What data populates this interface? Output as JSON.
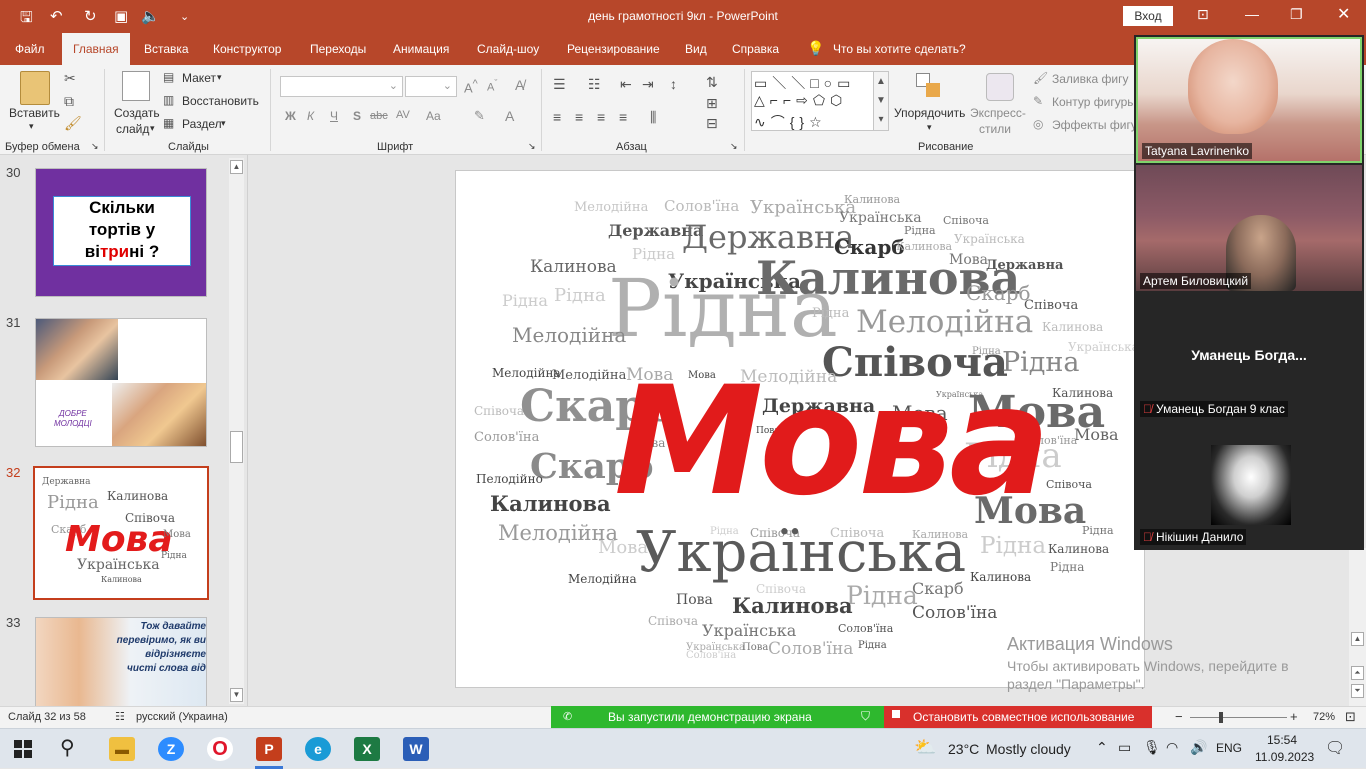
{
  "titlebar": {
    "document_title": "день грамотності 9кл",
    "separator": " - ",
    "app_name": "PowerPoint",
    "signin_label": "Вход"
  },
  "tabs": [
    {
      "label": "Файл"
    },
    {
      "label": "Главная"
    },
    {
      "label": "Вставка"
    },
    {
      "label": "Конструктор"
    },
    {
      "label": "Переходы"
    },
    {
      "label": "Анимация"
    },
    {
      "label": "Слайд-шоу"
    },
    {
      "label": "Рецензирование"
    },
    {
      "label": "Вид"
    },
    {
      "label": "Справка"
    }
  ],
  "tell_me": "Что вы хотите сделать?",
  "ribbon": {
    "clipboard": {
      "paste": "Вставить",
      "group": "Буфер обмена"
    },
    "slides": {
      "new_slide_line1": "Создать",
      "new_slide_line2": "слайд",
      "layout": "Макет",
      "reset": "Восстановить",
      "section": "Раздел",
      "group": "Слайды"
    },
    "font": {
      "group": "Шрифт",
      "bold": "Ж",
      "italic": "К",
      "underline": "Ч",
      "shadow": "S",
      "strike": "abc",
      "spacing": "AV",
      "case": "Aa"
    },
    "paragraph": {
      "group": "Абзац"
    },
    "drawing": {
      "arrange": "Упорядочить",
      "styles_line1": "Экспресс-",
      "styles_line2": "стили",
      "fill": "Заливка фигу",
      "outline": "Контур фигуры",
      "effects": "Эффекты фигу",
      "group": "Рисование"
    }
  },
  "thumbnails": [
    {
      "num": "30",
      "line1": "Скільки",
      "line2": "тортів у",
      "line3a": "ві",
      "line3b": "три",
      "line3c": "ні ?"
    },
    {
      "num": "31",
      "caption1": "ДОБРЕ",
      "caption2": "МОЛОДЦІ"
    },
    {
      "num": "32"
    },
    {
      "num": "33",
      "text": "Тож давайте перевіримо, як ви відрізняєте чисті слова від"
    }
  ],
  "slide_words": {
    "main": "Мова",
    "ukr": "Українська",
    "kalynova": "Калинова",
    "ridna": "Рідна",
    "spivocha": "Співоча",
    "skarb": "Скарб",
    "derzhavna": "Державна",
    "melodiyna": "Мелодійна",
    "solovyina": "Солов'їна",
    "pova": "Пова"
  },
  "video": [
    {
      "name": "Tatyana Lavrinenko",
      "muted": false
    },
    {
      "name": "Артем Биловицкий",
      "muted": false
    },
    {
      "name": "Уманець Богдан 9 клас",
      "big_label": "Уманець  Богда...",
      "muted": true
    },
    {
      "name": "Нікішин Данило",
      "muted": true
    }
  ],
  "watermark": {
    "title": "Активация Windows",
    "line1": "Чтобы активировать Windows, перейдите в",
    "line2": "раздел \"Параметры\"."
  },
  "statusbar": {
    "slide_counter": "Слайд 32 из 58",
    "language": "русский (Украина)",
    "zoom": "72%",
    "zoom_minus": "−",
    "zoom_plus": "+"
  },
  "share": {
    "started": "Вы запустили демонстрацию экрана",
    "stop": "Остановить совместное использование"
  },
  "taskbar": {
    "weather_temp": "23°C",
    "weather_desc": "Mostly cloudy",
    "lang": "ENG",
    "time": "15:54",
    "date": "11.09.2023"
  }
}
